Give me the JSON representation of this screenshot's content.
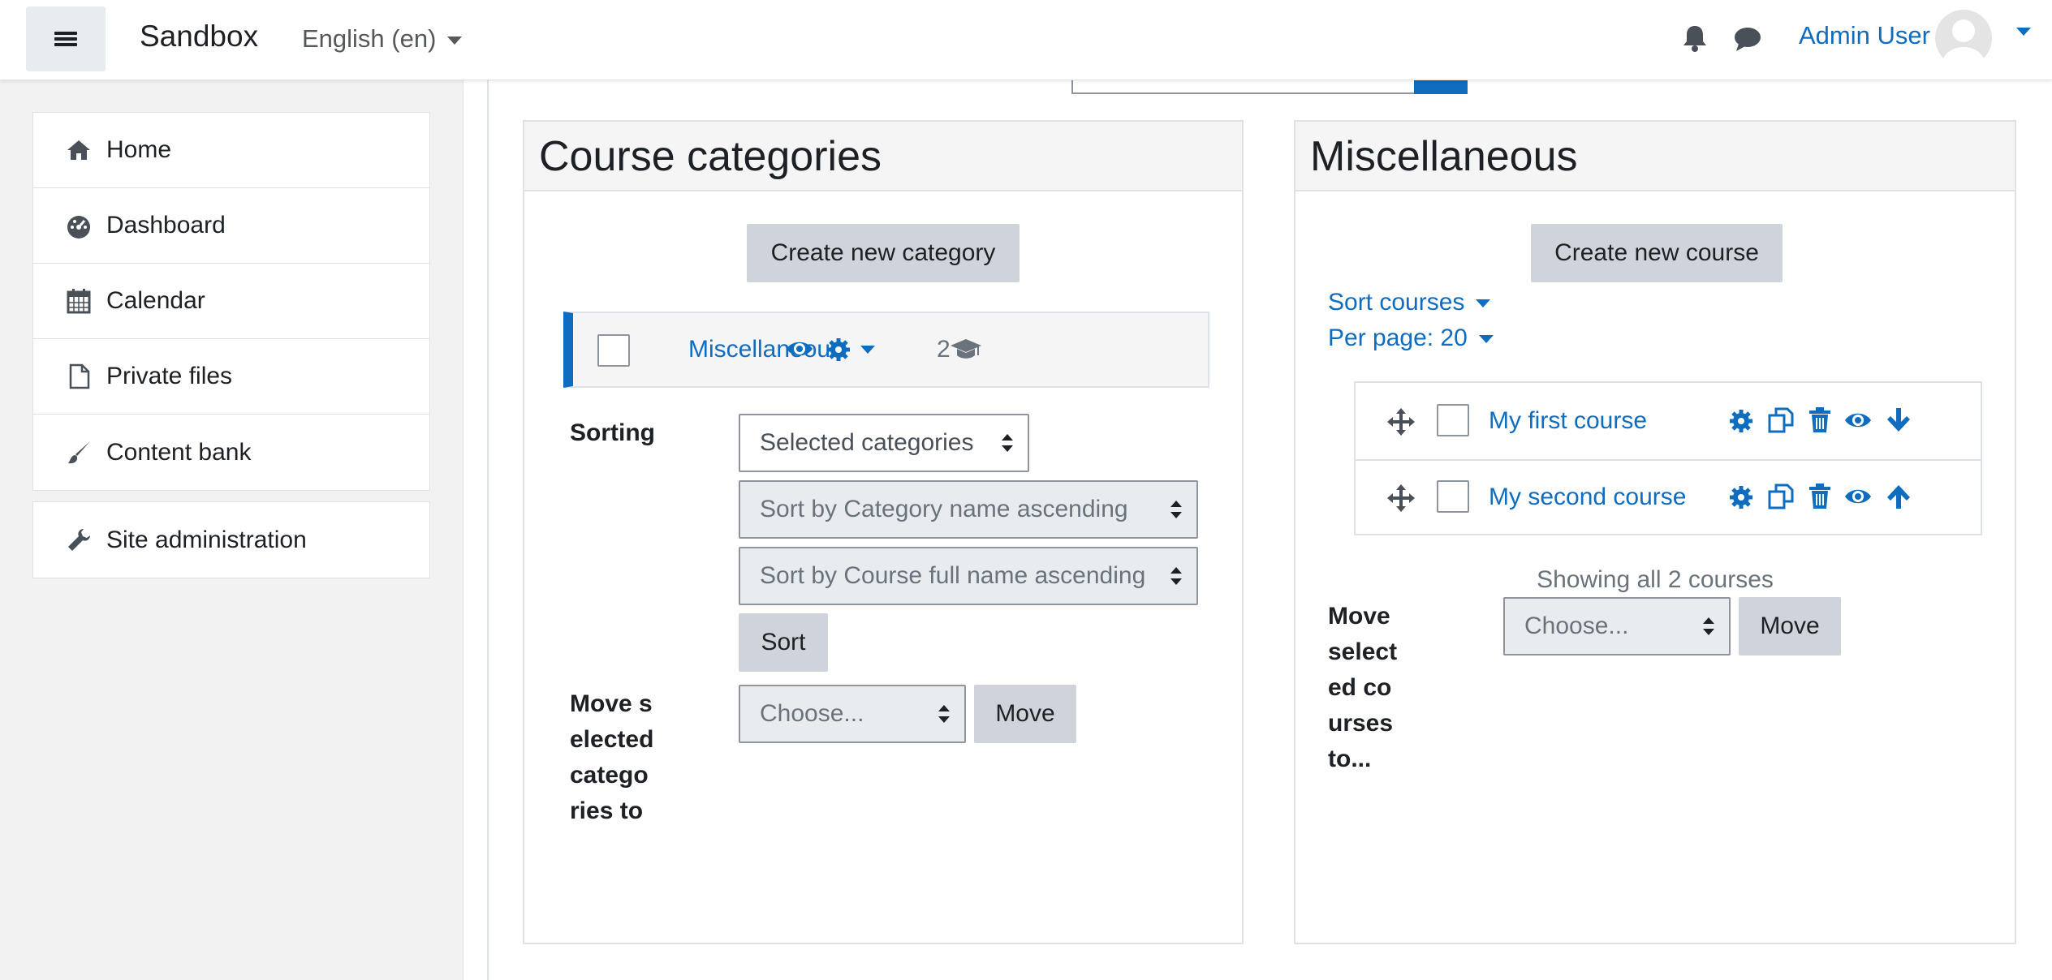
{
  "navbar": {
    "site_name": "Sandbox",
    "language": "English (en)",
    "user_name": "Admin User"
  },
  "drawer": {
    "items": [
      {
        "label": "Home",
        "icon": "home-icon"
      },
      {
        "label": "Dashboard",
        "icon": "dashboard-icon"
      },
      {
        "label": "Calendar",
        "icon": "calendar-icon"
      },
      {
        "label": "Private files",
        "icon": "file-icon"
      },
      {
        "label": "Content bank",
        "icon": "paintbrush-icon"
      }
    ],
    "admin": {
      "label": "Site administration",
      "icon": "wrench-icon"
    }
  },
  "categories_panel": {
    "title": "Course categories",
    "create_button": "Create new category",
    "category": {
      "name": "Miscellaneous",
      "course_count": "2"
    },
    "sorting_label": "Sorting",
    "sort_scope": "Selected categories",
    "sort_categories": "Sort by Category name ascending",
    "sort_courses": "Sort by Course full name ascending",
    "sort_button": "Sort",
    "move_label": "Move selected categories to",
    "move_select": "Choose...",
    "move_button": "Move"
  },
  "courses_panel": {
    "title": "Miscellaneous",
    "create_button": "Create new course",
    "sort_courses": "Sort courses",
    "per_page": "Per page: 20",
    "courses": [
      {
        "name": "My first course",
        "move_arrow": "arrow-down-icon"
      },
      {
        "name": "My second course",
        "move_arrow": "arrow-up-icon"
      }
    ],
    "showing": "Showing all 2 courses",
    "move_label": "Move selected courses to...",
    "move_select": "Choose...",
    "move_button": "Move"
  },
  "colors": {
    "link": "#0f6cbf",
    "secondary_button": "#ced4da",
    "drawer_bg": "#f2f2f2"
  }
}
